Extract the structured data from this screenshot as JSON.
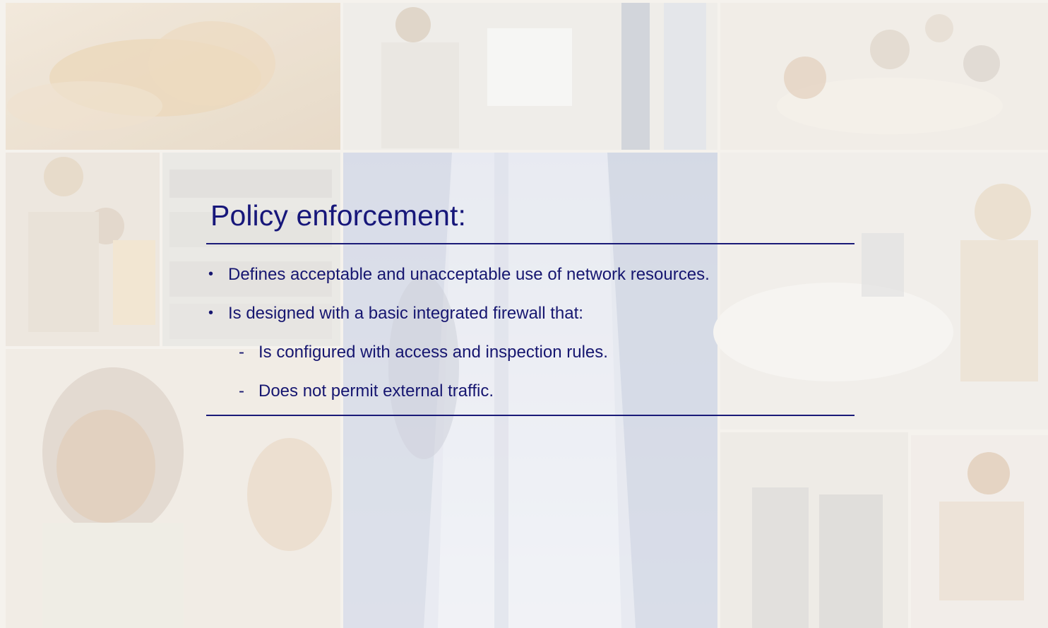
{
  "slide": {
    "title": "Policy enforcement:",
    "bullets": [
      {
        "text": "Defines acceptable and unacceptable use of network resources.",
        "subs": []
      },
      {
        "text": "Is designed with a basic integrated firewall that:",
        "subs": [
          "Is configured with access and inspection rules.",
          "Does not permit external traffic."
        ]
      }
    ],
    "bullet_marker": "•",
    "sub_marker": "-"
  },
  "colors": {
    "title_text": "#17177a",
    "body_text": "#161670",
    "rule": "#1a1a78",
    "background": "#f4f1ee"
  },
  "background_collage": [
    "handshake-photo",
    "man-at-computer-photo",
    "meeting-photo",
    "coworkers-at-desk-photo",
    "server-rack-photo",
    "datacenter-aisle-photo",
    "woman-with-laptop-photo",
    "smiling-woman-photo",
    "woman-in-office-photo",
    "server-cabinets-photo",
    "woman-reading-photo"
  ]
}
